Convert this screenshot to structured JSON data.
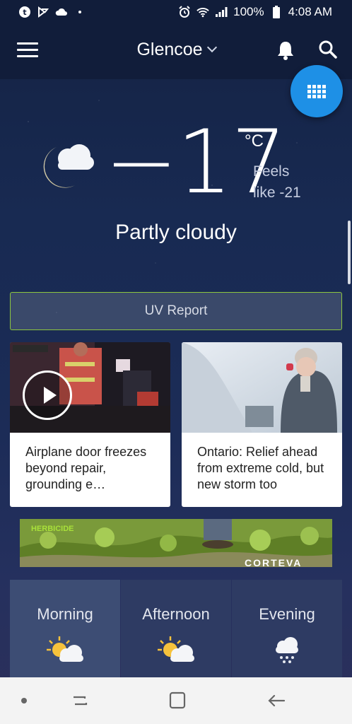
{
  "status_bar": {
    "battery": "100%",
    "time": "4:08 AM"
  },
  "app_bar": {
    "location": "Glencoe"
  },
  "current": {
    "temperature": "−17",
    "unit": "°C",
    "feels_like": "Feels like -21",
    "condition": "Partly cloudy"
  },
  "uv_report": {
    "label": "UV Report"
  },
  "news": [
    {
      "headline": "Airplane door freezes beyond repair, grounding e…",
      "type": "video"
    },
    {
      "headline": "Ontario: Relief ahead from extreme cold, but new storm too",
      "type": "article"
    }
  ],
  "ad": {
    "headline_text": "HERBICIDE",
    "brand": "CORTEVA"
  },
  "forecast_tabs": [
    {
      "label": "Morning",
      "icon": "partly-sunny-icon"
    },
    {
      "label": "Afternoon",
      "icon": "partly-sunny-icon"
    },
    {
      "label": "Evening",
      "icon": "snow-cloud-icon"
    }
  ],
  "colors": {
    "fab": "#1e90e6",
    "uv_border": "#8dc63f",
    "app_bar": "#111d3a"
  }
}
